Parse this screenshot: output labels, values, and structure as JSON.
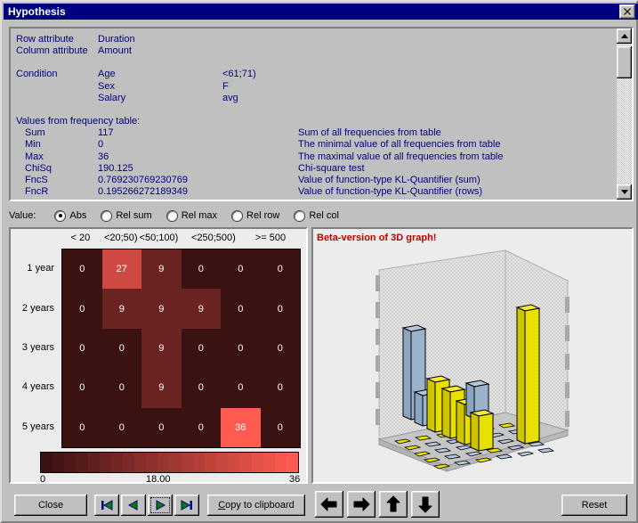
{
  "window": {
    "title": "Hypothesis",
    "close_label": "✕"
  },
  "info": {
    "rows": [
      {
        "label": "Row attribute",
        "value": "Duration",
        "extra": ""
      },
      {
        "label": "Column attribute",
        "value": "Amount",
        "extra": ""
      }
    ],
    "condition_label": "Condition",
    "conditions": [
      {
        "name": "Age",
        "value": "<61;71)"
      },
      {
        "name": "Sex",
        "value": "F"
      },
      {
        "name": "Salary",
        "value": "avg"
      }
    ],
    "values_heading": "Values from frequency table:",
    "values": [
      {
        "name": "Sum",
        "value": "117",
        "desc": "Sum of all frequencies from table"
      },
      {
        "name": "Min",
        "value": "0",
        "desc": "The minimal value of all frequencies from table"
      },
      {
        "name": "Max",
        "value": "36",
        "desc": "The maximal value of all frequencies from table"
      },
      {
        "name": "ChiSq",
        "value": "190.125",
        "desc": "Chi-square test"
      },
      {
        "name": "FncS",
        "value": "0.769230769230769",
        "desc": "Value of function-type KL-Quantifier (sum)"
      },
      {
        "name": "FncR",
        "value": "0.195266272189349",
        "desc": "Value of function-type KL-Quantifier (rows)"
      }
    ]
  },
  "value_mode": {
    "label": "Value:",
    "options": [
      {
        "label": "Abs",
        "selected": true
      },
      {
        "label": "Rel sum",
        "selected": false
      },
      {
        "label": "Rel max",
        "selected": false
      },
      {
        "label": "Rel row",
        "selected": false
      },
      {
        "label": "Rel col",
        "selected": false
      }
    ]
  },
  "chart_data": {
    "type": "heatmap",
    "title": "",
    "xlabel": "Amount",
    "ylabel": "Duration",
    "categories": [
      "< 20",
      "<20;50)",
      "<50;100)",
      "",
      "<250;500)",
      ">= 500"
    ],
    "column_headers": [
      {
        "label": "< 20",
        "left_pct": 8
      },
      {
        "label": "<20;50)",
        "left_pct": 25
      },
      {
        "label": "<50;100)",
        "left_pct": 41
      },
      {
        "label": "<250;500)",
        "left_pct": 64
      },
      {
        "label": ">= 500",
        "left_pct": 88
      }
    ],
    "rows": [
      "1 year",
      "2 years",
      "3 years",
      "4 years",
      "5 years"
    ],
    "values": [
      [
        0,
        27,
        9,
        0,
        0,
        0
      ],
      [
        0,
        9,
        9,
        9,
        0,
        0
      ],
      [
        0,
        0,
        9,
        0,
        0,
        0
      ],
      [
        0,
        0,
        9,
        0,
        0,
        0
      ],
      [
        0,
        0,
        0,
        0,
        36,
        0
      ]
    ],
    "colorscale_min": 0,
    "colorscale_mid": 18,
    "colorscale_max": 36,
    "legend_ticks": [
      "0",
      "18.00",
      "36"
    ],
    "color_low": "#3a1212",
    "color_high": "#ff5b50"
  },
  "graph3d": {
    "beta_notice": "Beta-version of 3D graph!",
    "bar_color_a": "#8ba4c0",
    "bar_color_b": "#e8e000",
    "floor_color": "#c0c0c0"
  },
  "toolbar": {
    "close_label": "Close",
    "first_label": "|◀",
    "prev_label": "◀",
    "next_label": "▶",
    "last_label": "▶|",
    "copy_label_pre": "C",
    "copy_label_post": "opy to clipboard",
    "pan_left": "←",
    "pan_right": "→",
    "pan_up": "↑",
    "pan_down": "↓",
    "reset_label": "Reset"
  }
}
